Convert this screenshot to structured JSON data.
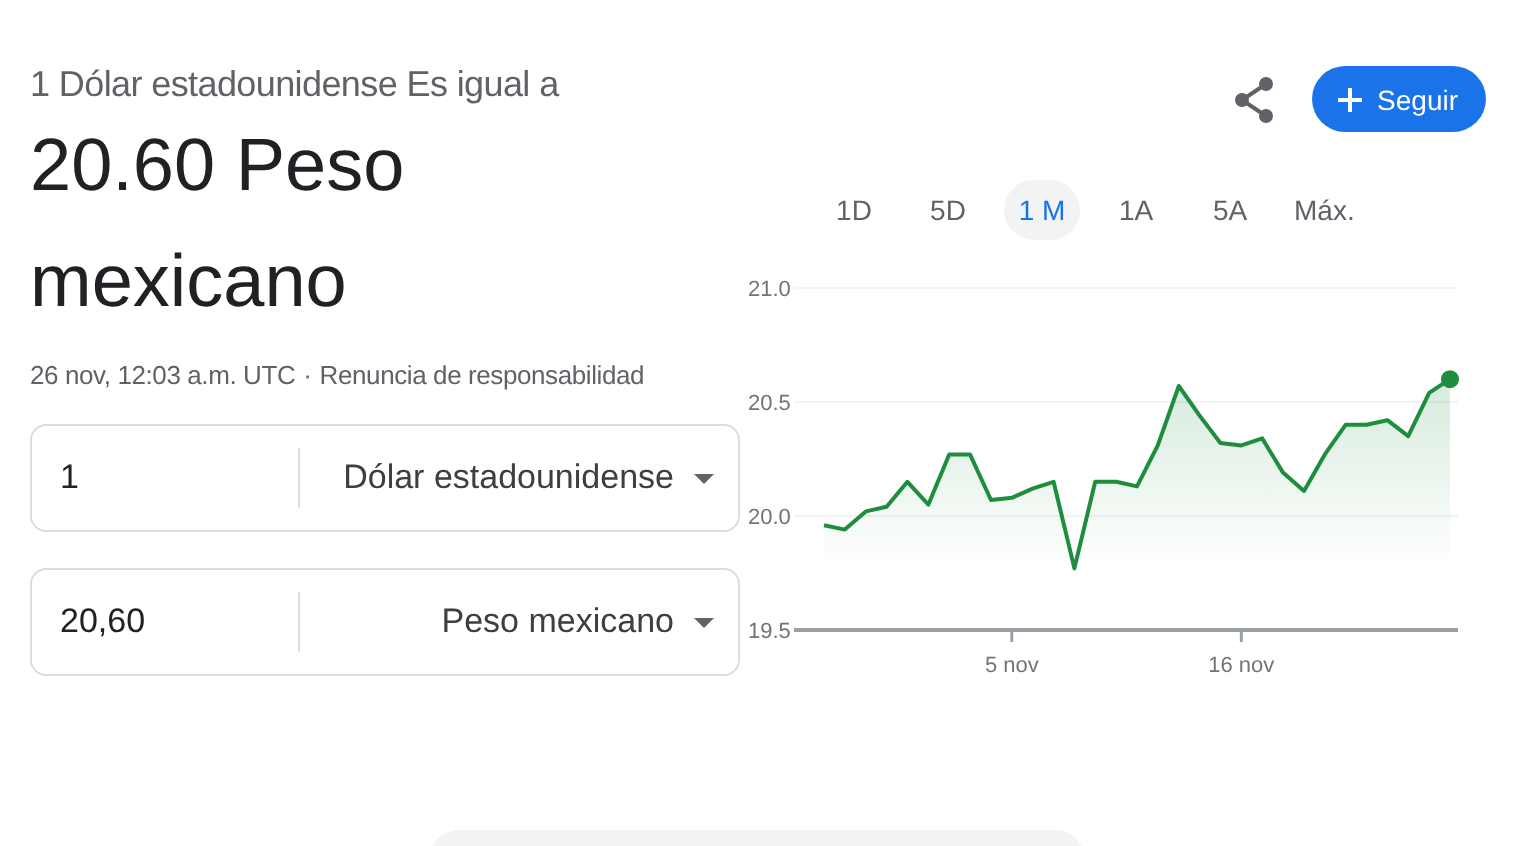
{
  "header": {
    "subtitle": "1 Dólar estadounidense Es igual a",
    "result": "20.60 Peso mexicano",
    "timestamp": "26 nov, 12:03 a.m. UTC",
    "separator": "·",
    "disclaimer": "Renuncia de responsabilidad"
  },
  "actions": {
    "follow_button": "Seguir"
  },
  "ranges": [
    {
      "label": "1D",
      "selected": false
    },
    {
      "label": "5D",
      "selected": false
    },
    {
      "label": "1 M",
      "selected": true
    },
    {
      "label": "1A",
      "selected": false
    },
    {
      "label": "5A",
      "selected": false
    },
    {
      "label": "Máx.",
      "selected": false
    }
  ],
  "converter": [
    {
      "value": "1",
      "currency": "Dólar estadounidense"
    },
    {
      "value": "20,60",
      "currency": "Peso mexicano"
    }
  ],
  "chart_data": {
    "type": "area",
    "categories": [
      null,
      null,
      null,
      null,
      null,
      null,
      null,
      null,
      null,
      "5 nov",
      null,
      null,
      null,
      null,
      null,
      null,
      null,
      null,
      null,
      null,
      "16 nov",
      null,
      null,
      null,
      null,
      null,
      null,
      null,
      null,
      null,
      null
    ],
    "series": [
      {
        "color": "#1e8e3e",
        "values": [
          19.96,
          19.94,
          20.02,
          20.04,
          20.15,
          20.05,
          20.27,
          20.27,
          20.07,
          20.08,
          20.12,
          20.15,
          19.77,
          20.15,
          20.15,
          20.13,
          20.31,
          20.57,
          20.44,
          20.32,
          20.31,
          20.34,
          20.19,
          20.11,
          20.27,
          20.4,
          20.4,
          20.42,
          20.35,
          20.54,
          20.6
        ]
      }
    ],
    "ylim": [
      19.5,
      21.0
    ],
    "yticks": [
      {
        "value": 19.5,
        "label": "19.5"
      },
      {
        "value": 20,
        "label": "20.0"
      },
      {
        "value": 20.5,
        "label": "20.5"
      },
      {
        "value": 21,
        "label": "21.0"
      }
    ]
  }
}
